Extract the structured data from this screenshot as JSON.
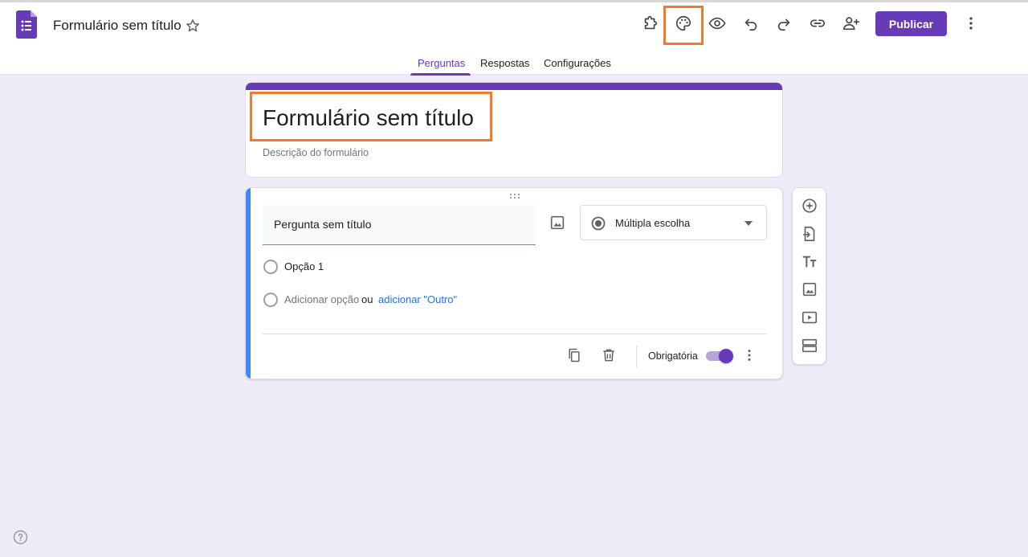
{
  "header": {
    "doc_title": "Formulário sem título",
    "publish_label": "Publicar",
    "accent_color": "#673ab7",
    "icons": [
      "forms-app-icon",
      "star-icon",
      "addon-puzzle-icon",
      "palette-icon",
      "preview-eye-icon",
      "undo-icon",
      "redo-icon",
      "link-icon",
      "add-collaborator-icon",
      "more-vert-icon"
    ]
  },
  "tabs": [
    {
      "label": "Perguntas",
      "active": true
    },
    {
      "label": "Respostas",
      "active": false
    },
    {
      "label": "Configurações",
      "active": false
    }
  ],
  "form": {
    "title": "Formulário sem título",
    "description_placeholder": "Descrição do formulário"
  },
  "question": {
    "title": "Pergunta sem título",
    "type": "Múltipla escolha",
    "options": [
      "Opção 1"
    ],
    "add_option": "Adicionar opção",
    "or": "ou",
    "add_other": "adicionar \"Outro\"",
    "required_label": "Obrigatória",
    "required": true
  },
  "side_toolbar": [
    "add-question-icon",
    "import-questions-icon",
    "add-title-icon",
    "add-image-icon",
    "add-video-icon",
    "add-section-icon"
  ],
  "annotations": {
    "highlight_color": "#f07a2e"
  }
}
